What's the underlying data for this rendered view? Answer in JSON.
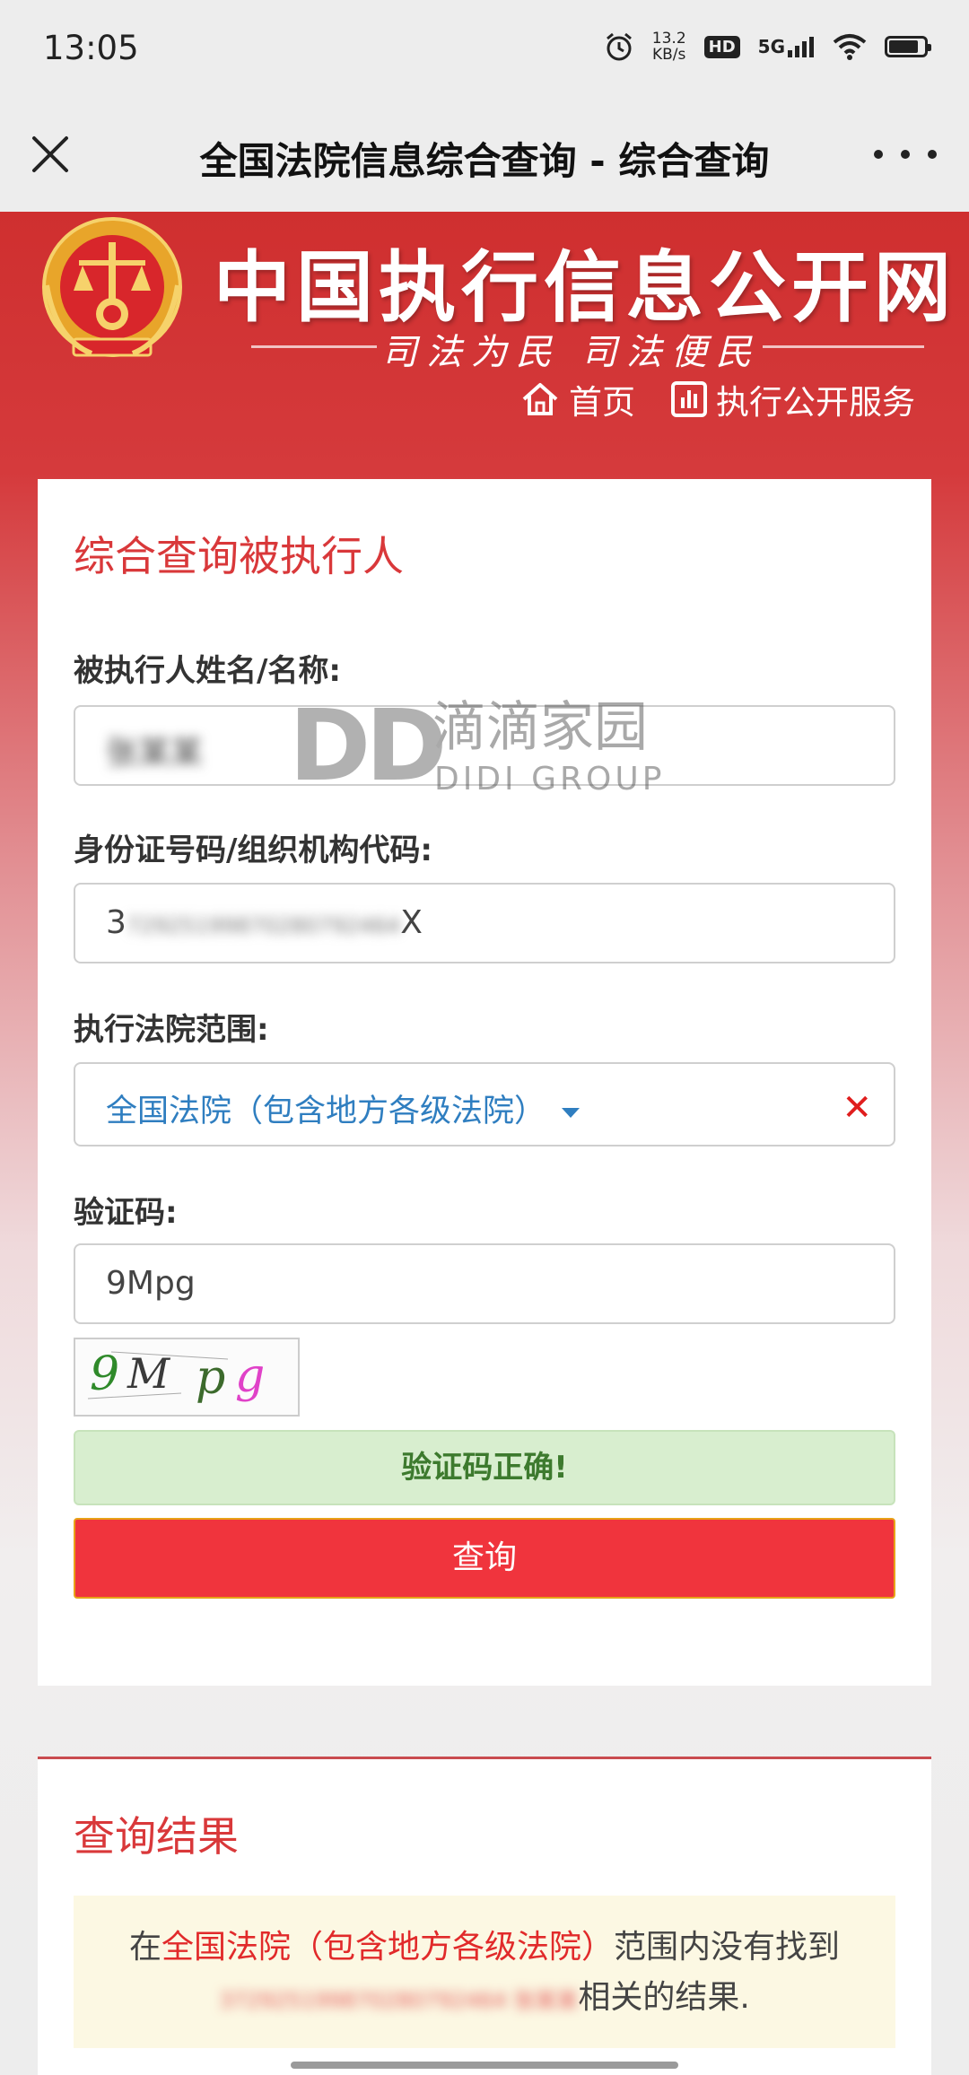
{
  "status_bar": {
    "time": "13:05",
    "net_speed_value": "13.2",
    "net_speed_unit": "KB/s",
    "hd_label": "HD",
    "signal_label": "5G"
  },
  "nav": {
    "title": "全国法院信息综合查询 - 综合查询"
  },
  "header": {
    "site_title": "中国执行信息公开网",
    "slogan": "司法为民  司法便民",
    "links": {
      "home": "首页",
      "service": "执行公开服务"
    }
  },
  "form": {
    "title": "综合查询被执行人",
    "name_label": "被执行人姓名/名称:",
    "name_value": "张某某",
    "id_label": "身份证号码/组织机构代码:",
    "id_prefix": "3",
    "id_hidden": "72925199870280792464",
    "id_suffix": "X",
    "court_label": "执行法院范围:",
    "court_value": "全国法院（包含地方各级法院）",
    "captcha_label": "验证码:",
    "captcha_value": "9Mpg",
    "captcha_success": "验证码正确!",
    "submit_label": "查询"
  },
  "watermark": {
    "logo": "DD",
    "cn": "滴滴家园",
    "en": "DIDI GROUP"
  },
  "result": {
    "title": "查询结果",
    "msg_pre": "在",
    "msg_scope": "全国法院（包含地方各级法院）",
    "msg_mid": "范围内没有找到",
    "msg_hidden": "372925199870280792464 张某某",
    "msg_post": "相关的结果."
  }
}
